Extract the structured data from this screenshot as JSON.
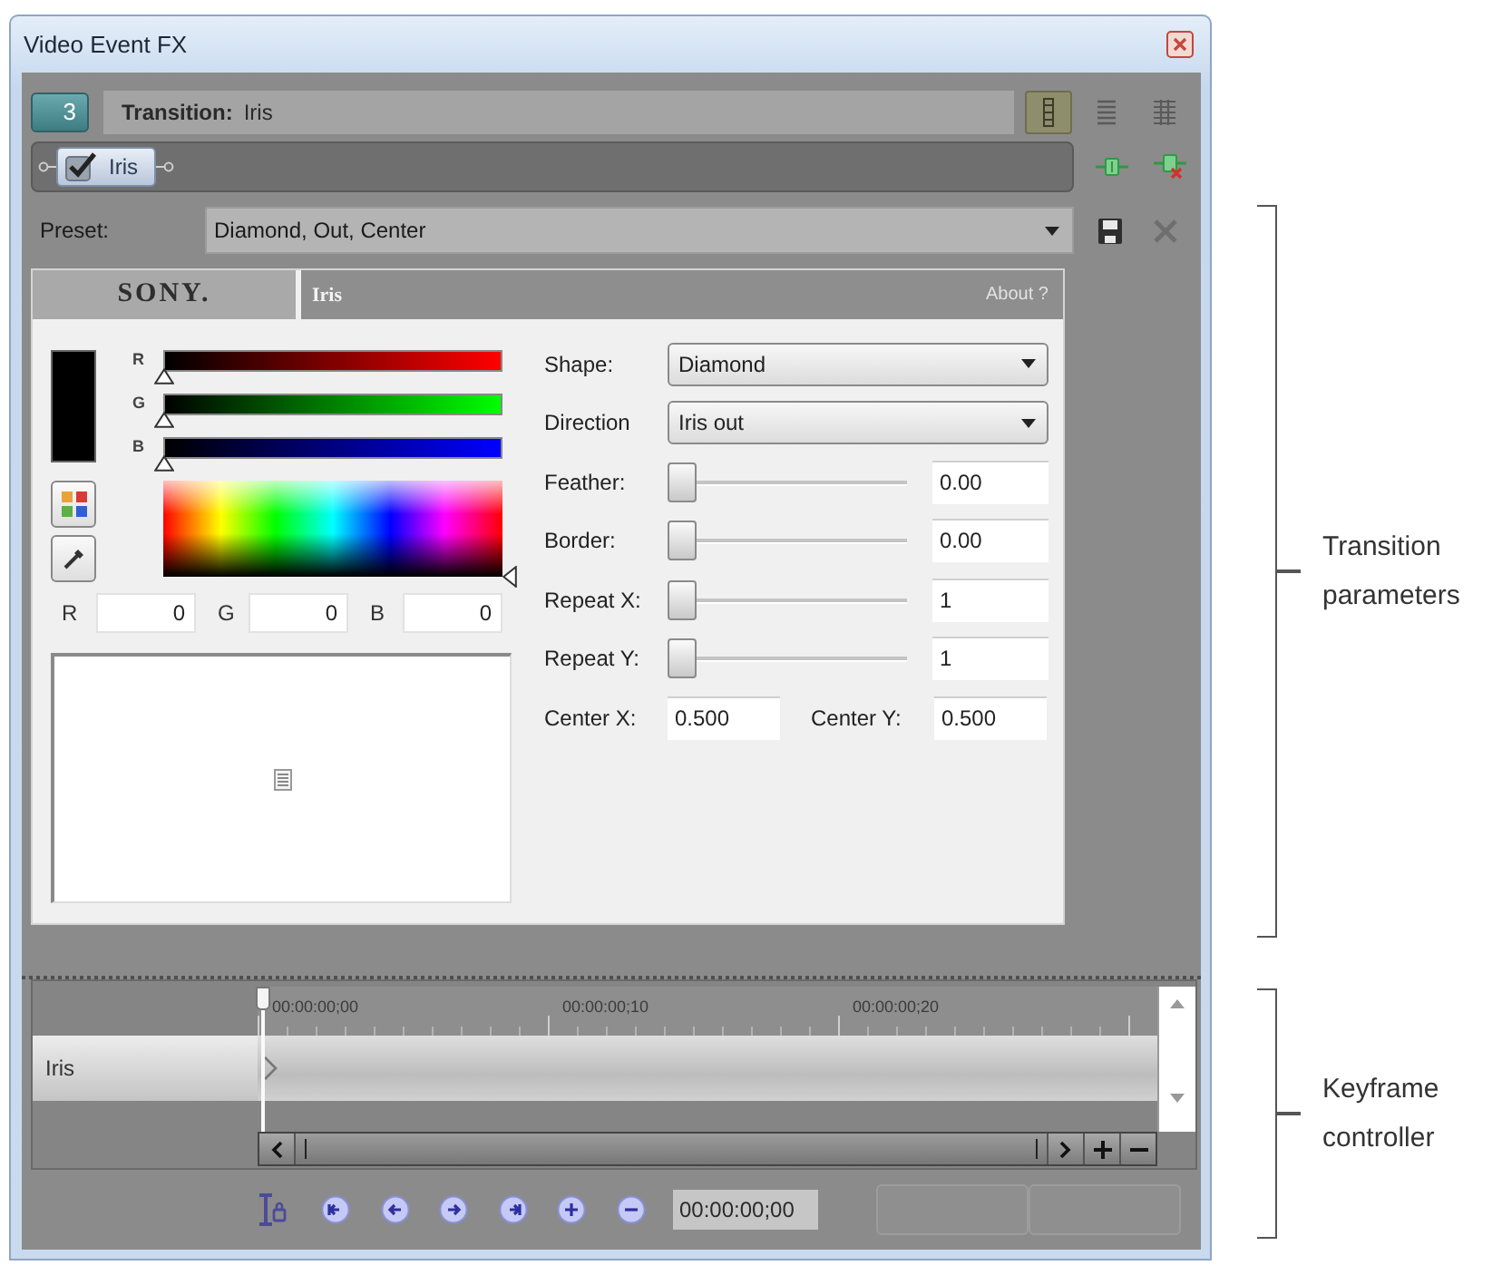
{
  "window": {
    "title": "Video Event FX"
  },
  "header": {
    "badge": "3",
    "label": "Transition:",
    "value": "Iris",
    "views": [
      {
        "selected": true
      },
      {
        "selected": false
      },
      {
        "selected": false
      }
    ]
  },
  "chain": {
    "plugins": [
      {
        "name": "Iris",
        "enabled": true
      }
    ]
  },
  "preset": {
    "label": "Preset:",
    "value": "Diamond, Out, Center"
  },
  "plugin": {
    "logo": "SONY.",
    "title": "Iris",
    "about": "About ?",
    "color": {
      "channels": [
        {
          "label": "R",
          "color": "#ff0000",
          "level": 0
        },
        {
          "label": "G",
          "color": "#00ff00",
          "level": 0
        },
        {
          "label": "B",
          "color": "#0000ff",
          "level": 0
        }
      ],
      "fields": [
        {
          "label": "R",
          "value": "0"
        },
        {
          "label": "G",
          "value": "0"
        },
        {
          "label": "B",
          "value": "0"
        }
      ]
    },
    "params": [
      {
        "kind": "dropdown",
        "label": "Shape:",
        "value": "Diamond"
      },
      {
        "kind": "dropdown",
        "label": "Direction",
        "value": "Iris out"
      },
      {
        "kind": "slider",
        "label": "Feather:",
        "level": 0,
        "value": "0.00"
      },
      {
        "kind": "slider",
        "label": "Border:",
        "level": 0,
        "value": "0.00"
      },
      {
        "kind": "slider",
        "label": "Repeat X:",
        "level": 0,
        "value": "1"
      },
      {
        "kind": "slider",
        "label": "Repeat Y:",
        "level": 0,
        "value": "1"
      },
      {
        "kind": "pair",
        "items": [
          {
            "label": "Center X:",
            "value": "0.500"
          },
          {
            "label": "Center Y:",
            "value": "0.500"
          }
        ]
      }
    ]
  },
  "keyframes": {
    "ruler": [
      "00:00:00;00",
      "00:00:00;10",
      "00:00:00;20"
    ],
    "tracks": [
      {
        "name": "Iris"
      }
    ],
    "time": "00:00:00;00",
    "buttons": [
      {
        "disabled": true
      },
      {
        "disabled": true
      }
    ]
  },
  "annotations": [
    {
      "text": "Transition parameters"
    },
    {
      "text": "Keyframe controller"
    }
  ]
}
